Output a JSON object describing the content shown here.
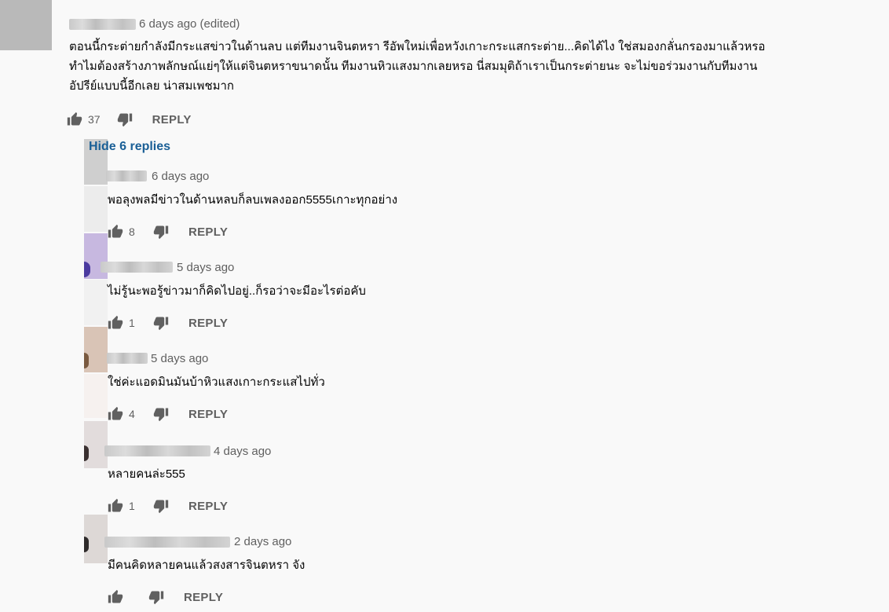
{
  "top_comment": {
    "time": "6 days ago (edited)",
    "text_lines": [
      "ตอนนี้กระต่ายกำลังมีกระแสข่าวในด้านลบ แต่ทีมงานจินตหรา รีอัพใหม่เพื่อหวังเกาะกระแสกระต่าย...คิดได้ไง ใช่สมองกลั่นกรองมาแล้วหรอ",
      "ทำไมต้องสร้างภาพลักษณ์แย่ๆให้แต่จินตหราขนาดนั้น  ทีมงานหิวแสงมากเลยหรอ นี่สมมุติถ้าเราเป็นกระต่ายนะ จะไม่ขอร่วมงานกับทีมงาน",
      "อัปรีย์แบบนี้อีกเลย น่าสมเพชมาก"
    ],
    "likes": "37",
    "reply_label": "REPLY"
  },
  "hide_replies_label": "Hide 6 replies",
  "replies": [
    {
      "time": "6 days ago",
      "text": "พอลุงพลมีข่าวในด้านหลบก็ลบเพลงออก5555เกาะทุกอย่าง",
      "likes": "8",
      "reply_label": "REPLY"
    },
    {
      "time": "5 days ago",
      "text": "ไม่รู้นะพอรู้ข่าวมาก็คิดไปอยู่..ก็รอว่าจะมีอะไรต่อคับ",
      "likes": "1",
      "reply_label": "REPLY"
    },
    {
      "time": "5 days ago",
      "text": "ใช่ค่ะแอดมินมันบ้าหิวแสงเกาะกระแสไปทั่ว",
      "likes": "4",
      "reply_label": "REPLY"
    },
    {
      "time": "4 days ago",
      "text": "หลายคนล่ะ555",
      "likes": "1",
      "reply_label": "REPLY"
    },
    {
      "time": "2 days ago",
      "text": "มีคนคิดหลายคนแล้วสงสารจินตหรา จัง",
      "likes": "",
      "reply_label": "REPLY"
    }
  ],
  "icons": {
    "like": "thumbs-up-icon",
    "dislike": "thumbs-down-icon"
  },
  "colors": {
    "background": "#f9f9f9",
    "text": "#030303",
    "meta": "#606060",
    "link": "#1a5f96"
  }
}
